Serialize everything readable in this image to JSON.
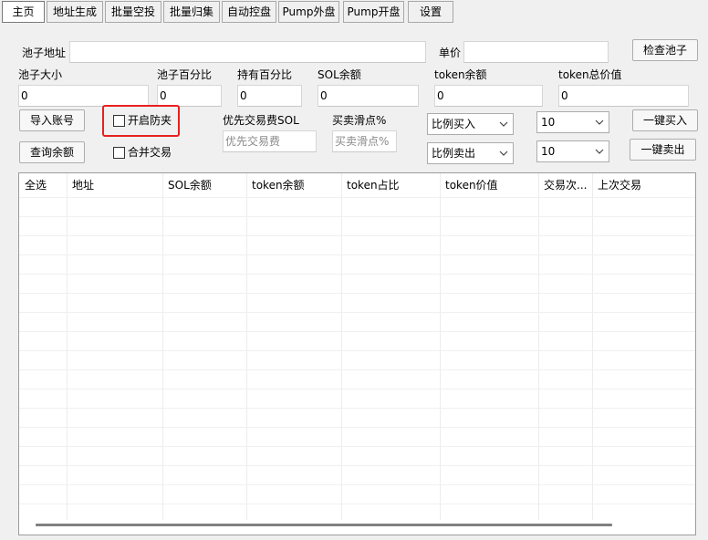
{
  "tabs": [
    "主页",
    "地址生成",
    "批量空投",
    "批量归集",
    "自动控盘",
    "Pump外盘",
    "Pump开盘",
    "设置"
  ],
  "pool": {
    "address_label": "池子地址",
    "address_value": "",
    "price_label": "单价",
    "price_value": "",
    "check_button": "检查池子"
  },
  "stats": {
    "pool_size_label": "池子大小",
    "pool_size_value": "0",
    "pool_pct_label": "池子百分比",
    "pool_pct_value": "0",
    "hold_pct_label": "持有百分比",
    "hold_pct_value": "0",
    "sol_balance_label": "SOL余额",
    "sol_balance_value": "0",
    "token_balance_label": "token余额",
    "token_balance_value": "0",
    "token_total_label": "token总价值",
    "token_total_value": "0"
  },
  "actions": {
    "import_button": "导入账号",
    "query_button": "查询余额",
    "anti_clip_label": "开启防夹",
    "merge_trade_label": "合并交易",
    "priority_fee_label": "优先交易费SOL",
    "priority_fee_placeholder": "优先交易费",
    "slippage_label": "买卖滑点%",
    "slippage_placeholder": "买卖滑点%",
    "buy_mode": "比例买入",
    "sell_mode": "比例卖出",
    "buy_amount": "10",
    "sell_amount": "10",
    "buy_all_button": "一键买入",
    "sell_all_button": "一键卖出"
  },
  "table": {
    "columns": [
      "全选",
      "地址",
      "SOL余额",
      "token余额",
      "token占比",
      "token价值",
      "交易次...",
      "上次交易"
    ],
    "rows": []
  }
}
